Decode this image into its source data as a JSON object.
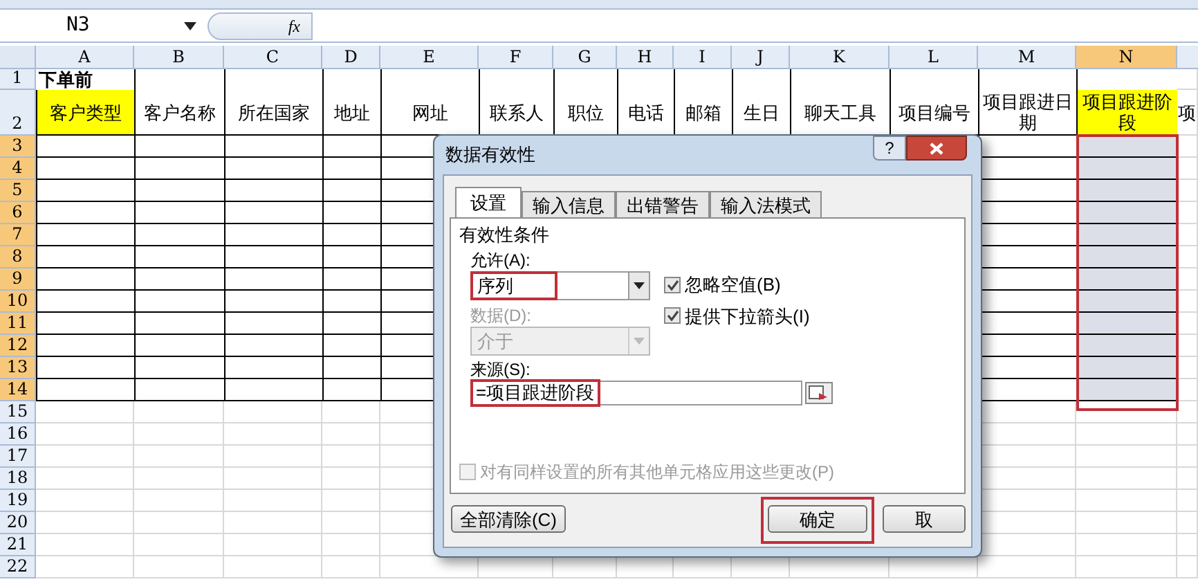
{
  "name_box": {
    "value": "N3"
  },
  "formula_bar": {
    "fx": "fx"
  },
  "columns": [
    {
      "label": "A",
      "selected": false
    },
    {
      "label": "B",
      "selected": false
    },
    {
      "label": "C",
      "selected": false
    },
    {
      "label": "D",
      "selected": false
    },
    {
      "label": "E",
      "selected": false
    },
    {
      "label": "F",
      "selected": false
    },
    {
      "label": "G",
      "selected": false
    },
    {
      "label": "H",
      "selected": false
    },
    {
      "label": "I",
      "selected": false
    },
    {
      "label": "J",
      "selected": false
    },
    {
      "label": "K",
      "selected": false
    },
    {
      "label": "L",
      "selected": false
    },
    {
      "label": "M",
      "selected": false
    },
    {
      "label": "N",
      "selected": true
    }
  ],
  "rows": [
    {
      "label": "1",
      "selected": false,
      "bordered": true,
      "cells": [
        {
          "text": "下单前",
          "bold": true,
          "highlight": false
        }
      ]
    },
    {
      "label": "2",
      "selected": false,
      "bordered": true,
      "cells": [
        {
          "text": "客户类型",
          "highlight": true
        },
        {
          "text": "客户名称",
          "highlight": false
        },
        {
          "text": "所在国家",
          "highlight": false
        },
        {
          "text": "地址",
          "highlight": false
        },
        {
          "text": "网址",
          "highlight": false
        },
        {
          "text": "联系人",
          "highlight": false
        },
        {
          "text": "职位",
          "highlight": false
        },
        {
          "text": "电话",
          "highlight": false
        },
        {
          "text": "邮箱",
          "highlight": false
        },
        {
          "text": "生日",
          "highlight": false
        },
        {
          "text": "聊天工具",
          "highlight": false
        },
        {
          "text": "项目编号",
          "highlight": false
        },
        {
          "text": "项目跟进日期",
          "highlight": false
        },
        {
          "text": "项目跟进阶段",
          "highlight": true
        },
        {
          "text": "项",
          "highlight": false
        }
      ]
    },
    {
      "label": "3",
      "selected": true,
      "bordered": true
    },
    {
      "label": "4",
      "selected": true,
      "bordered": true
    },
    {
      "label": "5",
      "selected": true,
      "bordered": true
    },
    {
      "label": "6",
      "selected": true,
      "bordered": true
    },
    {
      "label": "7",
      "selected": true,
      "bordered": true
    },
    {
      "label": "8",
      "selected": true,
      "bordered": true
    },
    {
      "label": "9",
      "selected": true,
      "bordered": true
    },
    {
      "label": "10",
      "selected": true,
      "bordered": true
    },
    {
      "label": "11",
      "selected": true,
      "bordered": true
    },
    {
      "label": "12",
      "selected": true,
      "bordered": true
    },
    {
      "label": "13",
      "selected": true,
      "bordered": true
    },
    {
      "label": "14",
      "selected": true,
      "bordered": true
    },
    {
      "label": "15",
      "selected": false,
      "bordered": false
    },
    {
      "label": "16",
      "selected": false,
      "bordered": false
    },
    {
      "label": "17",
      "selected": false,
      "bordered": false
    },
    {
      "label": "18",
      "selected": false,
      "bordered": false
    },
    {
      "label": "19",
      "selected": false,
      "bordered": false
    },
    {
      "label": "20",
      "selected": false,
      "bordered": false
    },
    {
      "label": "21",
      "selected": false,
      "bordered": false
    },
    {
      "label": "22",
      "selected": false,
      "bordered": false
    }
  ],
  "selection_annotated": true,
  "dialog": {
    "title": "数据有效性",
    "help": "?",
    "tabs": [
      {
        "label": "设置",
        "selected": true
      },
      {
        "label": "输入信息",
        "selected": false
      },
      {
        "label": "出错警告",
        "selected": false
      },
      {
        "label": "输入法模式",
        "selected": false
      }
    ],
    "group": "有效性条件",
    "allow": {
      "label": "允许(A):",
      "value": "序列",
      "annotated": true
    },
    "checkboxes": [
      {
        "label": "忽略空值(B)",
        "checked": true
      },
      {
        "label": "提供下拉箭头(I)",
        "checked": true
      }
    ],
    "data": {
      "label": "数据(D):",
      "value": "介于",
      "disabled": true
    },
    "source": {
      "label": "来源(S):",
      "value": "=项目跟进阶段",
      "annotated": true
    },
    "apply_all": {
      "label": "对有同样设置的所有其他单元格应用这些更改(P)",
      "checked": false,
      "disabled": true
    },
    "buttons": [
      {
        "label": "全部清除(C)",
        "annotated": false
      },
      {
        "label": "确定",
        "annotated": true
      },
      {
        "label": "取",
        "annotated": false
      }
    ]
  }
}
